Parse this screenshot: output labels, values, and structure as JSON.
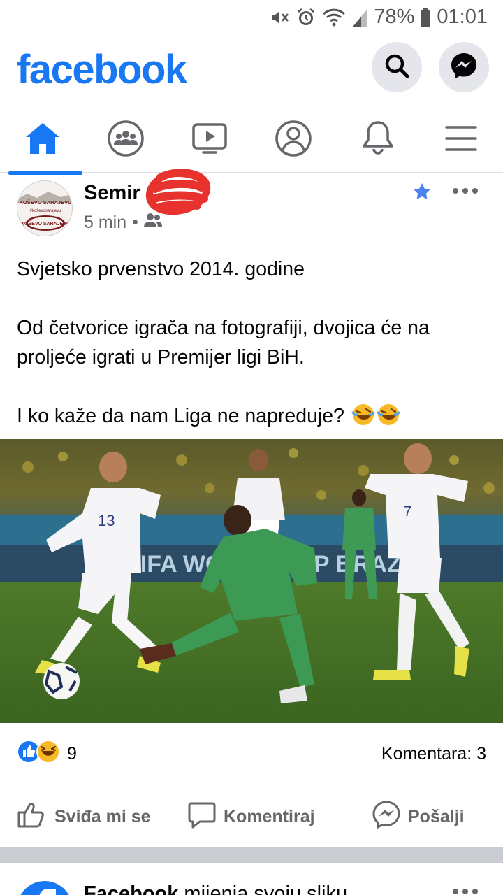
{
  "status": {
    "battery": "78%",
    "time": "01:01",
    "icons": [
      "mute-icon",
      "alarm-icon",
      "wifi-icon",
      "signal-icon",
      "battery-icon"
    ]
  },
  "header": {
    "logo": "facebook",
    "icons": [
      "search-icon",
      "messenger-icon"
    ]
  },
  "nav": {
    "tabs": [
      "home-icon",
      "groups-icon",
      "watch-icon",
      "profile-icon",
      "notifications-icon",
      "menu-icon"
    ],
    "active": "home"
  },
  "post": {
    "author": "Semir",
    "avatar_text_top": "KOŠEVO SARAJEVU",
    "avatar_text_mid": "#koševosarajevu",
    "avatar_text_logo": "KOŠEVO SARAJEVU",
    "time": "5 min",
    "privacy_icon": "friends-icon",
    "paragraphs": [
      "Svjetsko prvenstvo 2014. godine",
      "Od četvorice igrača na fotografiji, dvojica će na proljeće igrati u Premijer ligi BiH.",
      "I ko kaže da nam Liga ne napreduje?"
    ],
    "photo_banner": "FIFA WORLD CUP BRAZIL",
    "reaction_count": "9",
    "comments": "Komentara: 3",
    "actions": {
      "like": "Sviđa mi se",
      "comment": "Komentiraj",
      "share": "Pošalji"
    }
  },
  "next_post": {
    "author": "Facebook",
    "text": " mijenja svoju sliku"
  },
  "colors": {
    "brand": "#1877f2",
    "secondary_text": "#65676b",
    "divider": "#ced0d4"
  }
}
